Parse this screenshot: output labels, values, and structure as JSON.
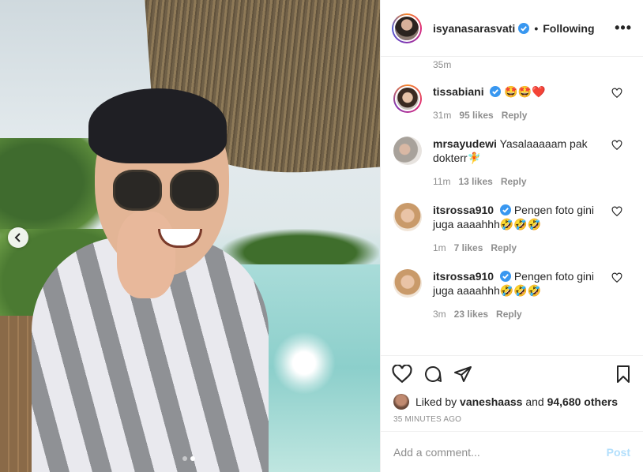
{
  "post": {
    "author": "isyanasarasvati",
    "follow_separator": "•",
    "follow_status": "Following",
    "more_label": "•••",
    "caption_time": "35m"
  },
  "comments": [
    {
      "user": "tissabiani",
      "verified": true,
      "text": "🤩🤩❤️",
      "time": "31m",
      "likes": "95 likes",
      "reply": "Reply"
    },
    {
      "user": "mrsayudewi",
      "verified": false,
      "text": "Yasalaaaaam pak dokterr🧚",
      "time": "11m",
      "likes": "13 likes",
      "reply": "Reply"
    },
    {
      "user": "itsrossa910",
      "verified": true,
      "text": "Pengen foto gini juga aaaahhh🤣🤣🤣",
      "time": "1m",
      "likes": "7 likes",
      "reply": "Reply"
    },
    {
      "user": "itsrossa910",
      "verified": true,
      "text": "Pengen foto gini juga aaaahhh🤣🤣🤣",
      "time": "3m",
      "likes": "23 likes",
      "reply": "Reply"
    }
  ],
  "likes": {
    "prefix": "Liked by",
    "user": "vaneshaass",
    "and": "and",
    "others": "94,680 others"
  },
  "timestamp": "35 MINUTES AGO",
  "add_comment": {
    "placeholder": "Add a comment...",
    "post_label": "Post"
  },
  "carousel": {
    "current": 2,
    "total": 2
  },
  "colors": {
    "verified": "#3897f0",
    "muted": "#8e8e8e",
    "post_button": "#b2dffc"
  },
  "icons": [
    "verified-icon",
    "more-options-icon",
    "heart-icon",
    "comment-icon",
    "share-icon",
    "bookmark-icon",
    "chevron-left-icon"
  ]
}
